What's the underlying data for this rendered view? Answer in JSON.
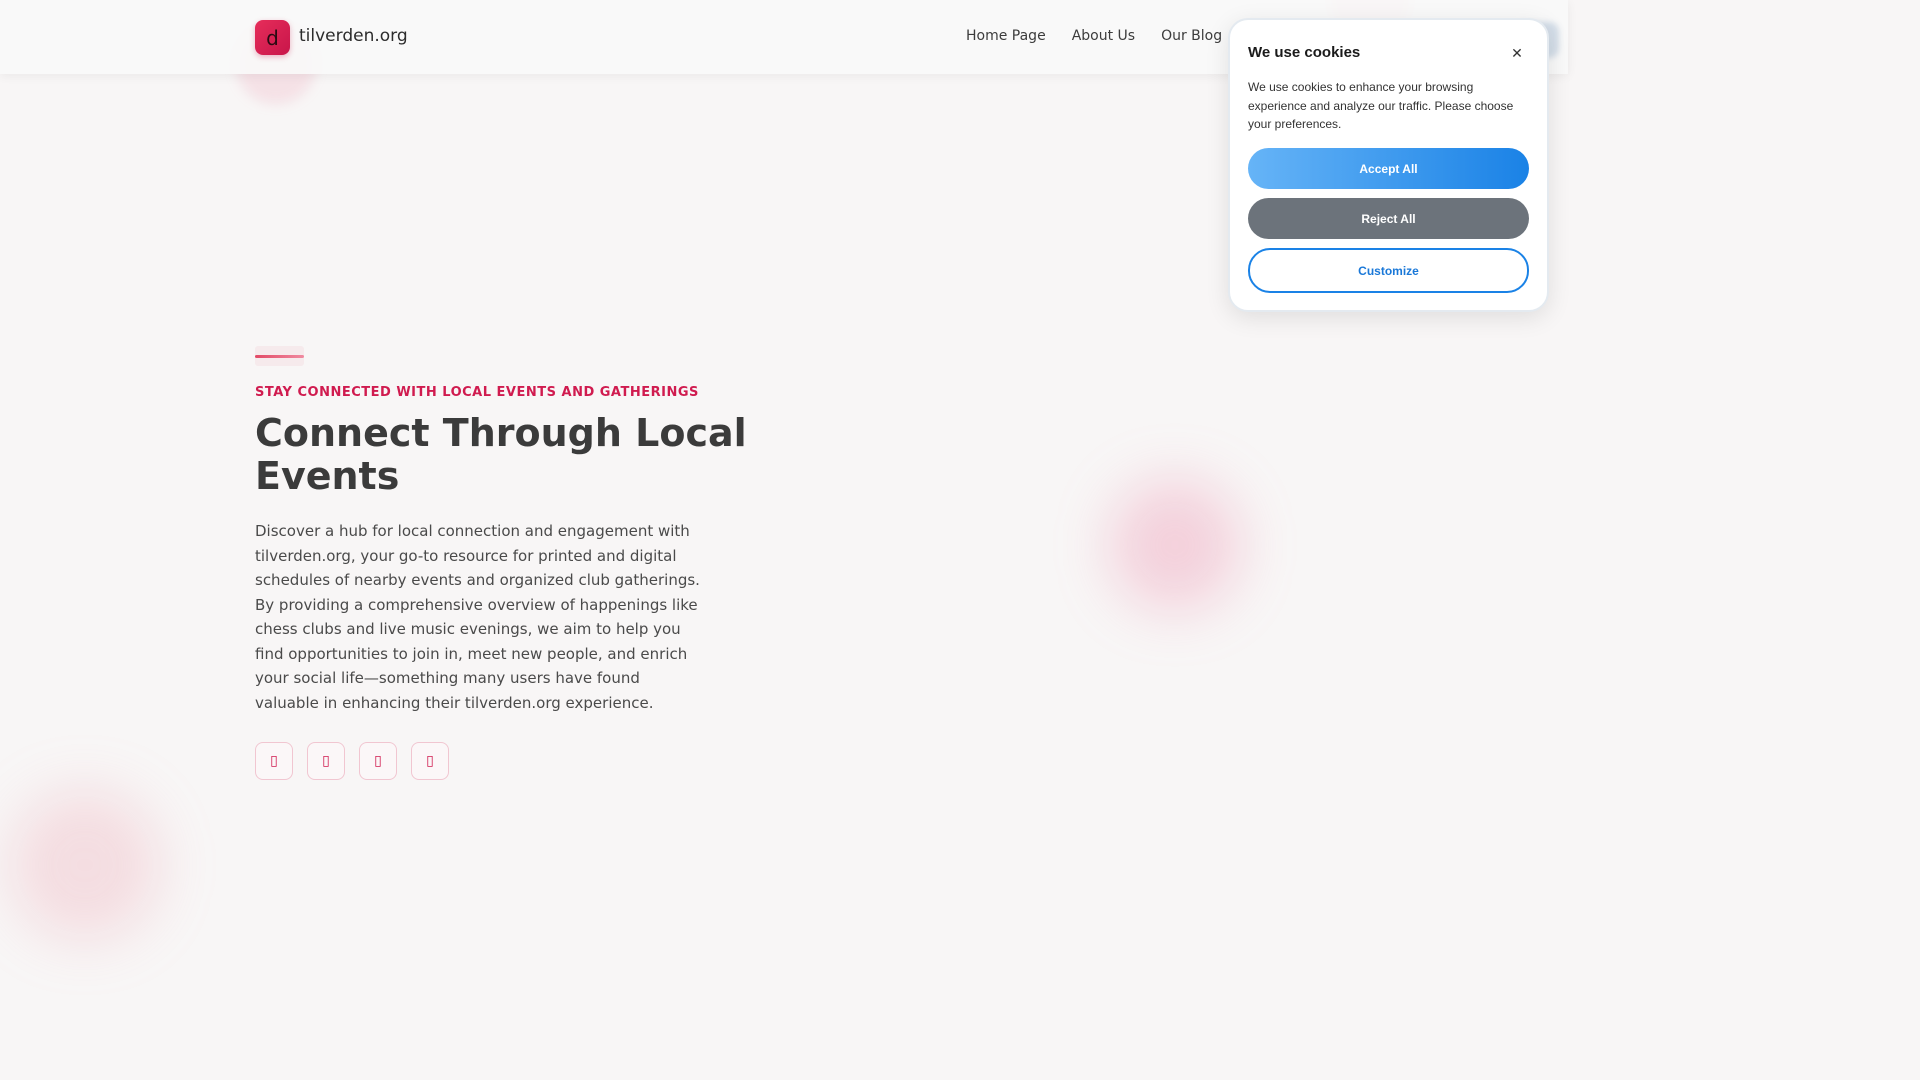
{
  "site": {
    "logo_letter": "d",
    "name": "tilverden.org"
  },
  "nav": {
    "items": [
      {
        "label": "Home Page"
      },
      {
        "label": "About Us"
      },
      {
        "label": "Our Blog"
      }
    ]
  },
  "hero": {
    "eyebrow": "STAY CONNECTED WITH LOCAL EVENTS AND GATHERINGS",
    "title": "Connect Through Local Events",
    "description": "Discover a hub for local connection and engagement with tilverden.org, your go-to resource for printed and digital schedules of nearby events and organized club gatherings. By providing a comprehensive overview of happenings like chess clubs and live music evenings, we aim to help you find opportunities to join in, meet new people, and enrich your social life—something many users have found valuable in enhancing their tilverden.org experience.",
    "social_icons": [
      "social-icon-1",
      "social-icon-2",
      "social-icon-3",
      "social-icon-4"
    ]
  },
  "cookie": {
    "title": "We use cookies",
    "close_glyph": "✕",
    "text": "We use cookies to enhance your browsing experience and analyze our traffic. Please choose your preferences.",
    "accept_label": "Accept All",
    "reject_label": "Reject All",
    "customize_label": "Customize"
  },
  "colors": {
    "brand": "#d01b4f",
    "accept": "#1a82e6",
    "reject": "#6c737b"
  }
}
